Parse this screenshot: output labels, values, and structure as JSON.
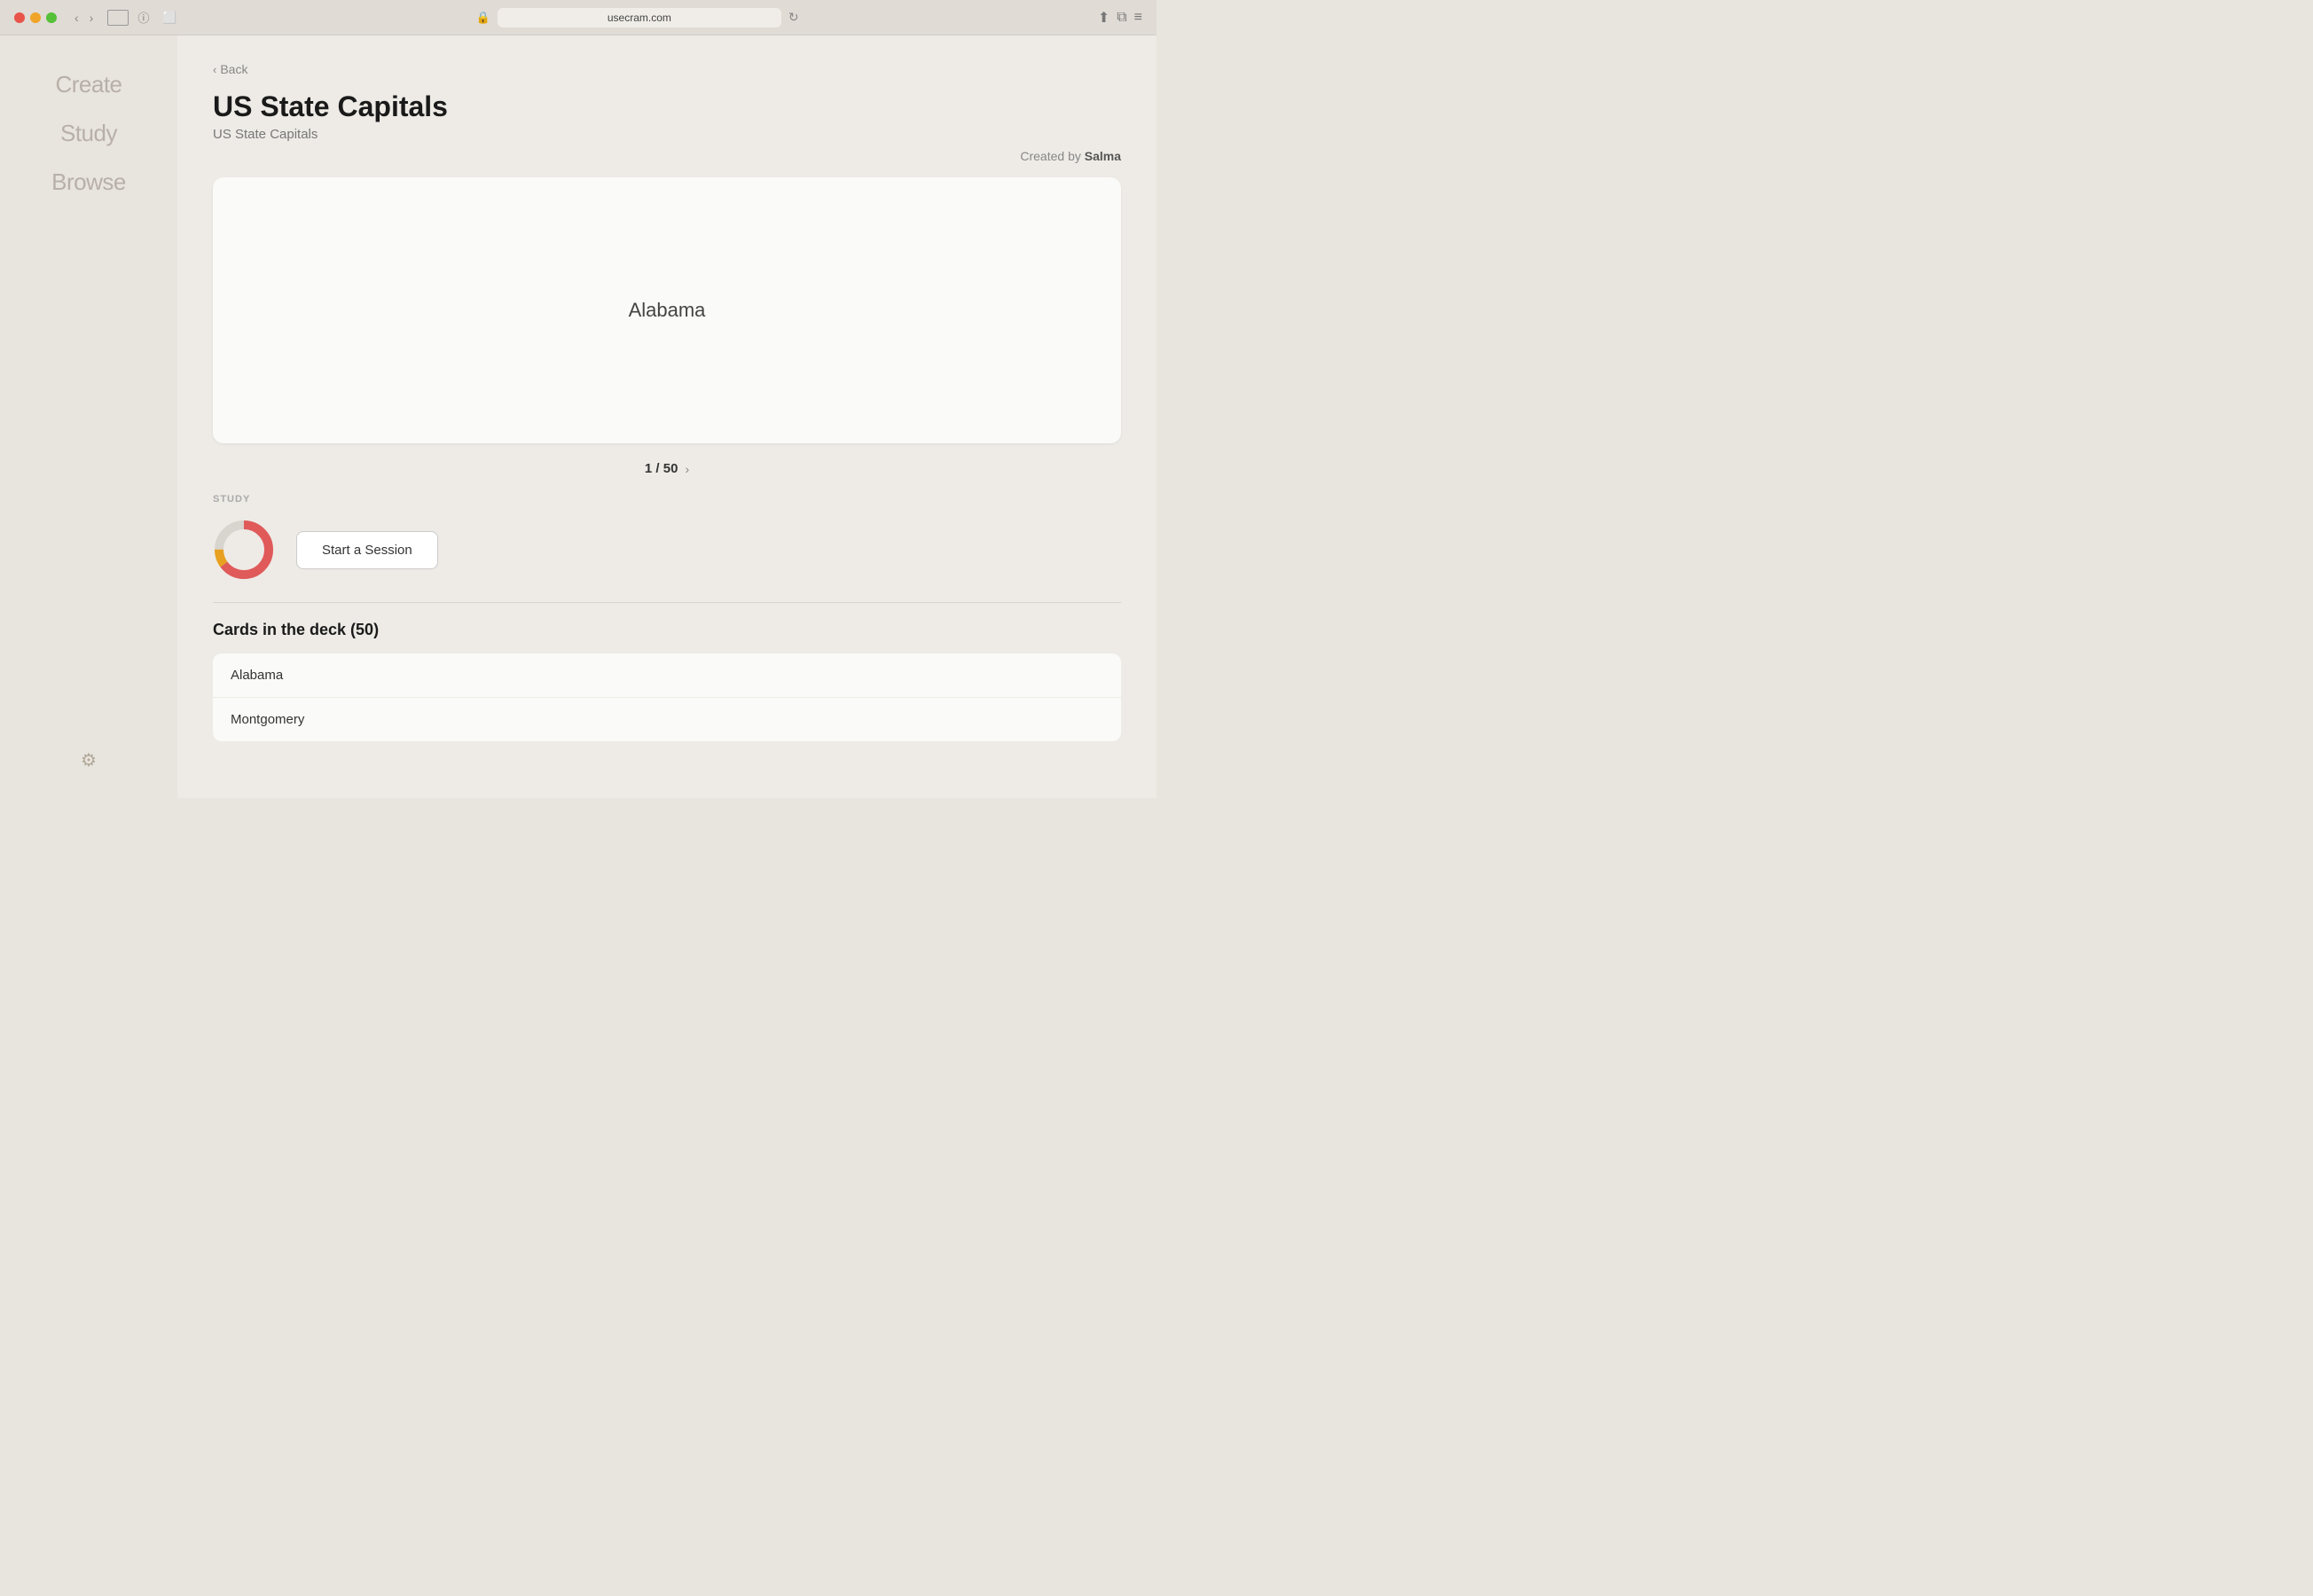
{
  "browser": {
    "url": "usecram.com",
    "back_label": "‹",
    "forward_label": "›"
  },
  "sidebar": {
    "items": [
      {
        "label": "Create",
        "id": "create"
      },
      {
        "label": "Study",
        "id": "study"
      },
      {
        "label": "Browse",
        "id": "browse"
      }
    ],
    "gear_icon": "⚙"
  },
  "back_link": "Back",
  "deck": {
    "title": "US State Capitals",
    "subtitle": "US State Capitals",
    "created_by_label": "Created by",
    "creator": "Salma"
  },
  "flashcard": {
    "current_word": "Alabama"
  },
  "pagination": {
    "current": "1",
    "total": "50",
    "separator": "/"
  },
  "study_section": {
    "label": "STUDY",
    "donut": {
      "red_pct": 65,
      "yellow_pct": 10,
      "gray_pct": 25
    },
    "start_button": "Start a Session"
  },
  "cards_in_deck": {
    "title": "Cards in the deck (50)",
    "cards": [
      {
        "front": "Alabama",
        "back": ""
      },
      {
        "front": "Montgomery",
        "back": ""
      }
    ]
  }
}
